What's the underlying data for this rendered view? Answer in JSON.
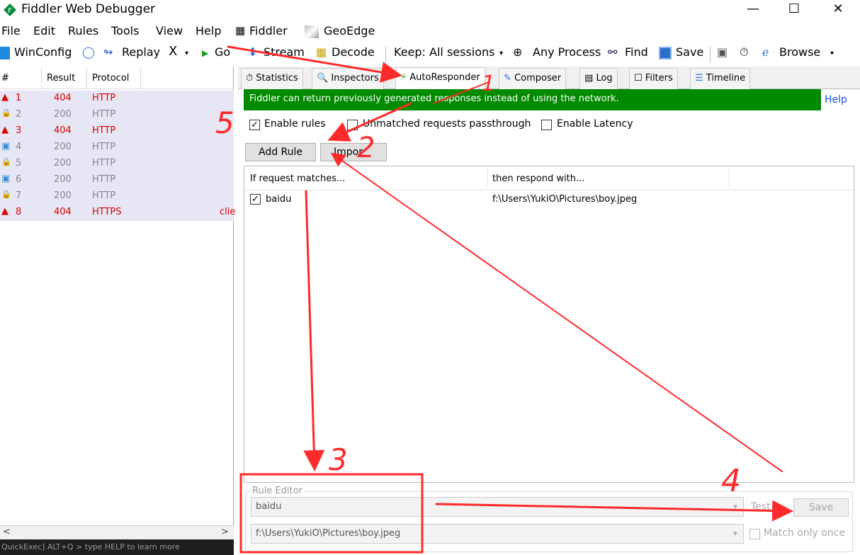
{
  "window": {
    "title": "Fiddler Web Debugger",
    "minimize": "—",
    "maximize": "☐",
    "close": "✕"
  },
  "menu": [
    "File",
    "Edit",
    "Rules",
    "Tools",
    "View",
    "Help",
    "Fiddler",
    "GeoEdge"
  ],
  "toolbar": {
    "winconfig": "WinConfig",
    "replay": "Replay",
    "x": "X",
    "go": "Go",
    "stream": "Stream",
    "decode": "Decode",
    "keep": "Keep: All sessions",
    "process": "Any Process",
    "find": "Find",
    "save": "Save",
    "browse": "Browse"
  },
  "sessions": {
    "headers": {
      "num": "#",
      "result": "Result",
      "protocol": "Protocol"
    },
    "rows": [
      {
        "num": "1",
        "result": "404",
        "protocol": "HTTP",
        "status": "error"
      },
      {
        "num": "2",
        "result": "200",
        "protocol": "HTTP",
        "status": "ok"
      },
      {
        "num": "3",
        "result": "404",
        "protocol": "HTTP",
        "status": "error"
      },
      {
        "num": "4",
        "result": "200",
        "protocol": "HTTP",
        "status": "ok"
      },
      {
        "num": "5",
        "result": "200",
        "protocol": "HTTP",
        "status": "ok"
      },
      {
        "num": "6",
        "result": "200",
        "protocol": "HTTP",
        "status": "ok"
      },
      {
        "num": "7",
        "result": "200",
        "protocol": "HTTP",
        "status": "ok"
      },
      {
        "num": "8",
        "result": "404",
        "protocol": "HTTPS",
        "status": "error",
        "extra": "clie"
      }
    ],
    "quickexec": "QuickExec] ALT+Q > type HELP to learn more"
  },
  "tabs": [
    "Statistics",
    "Inspectors",
    "AutoResponder",
    "Composer",
    "Log",
    "Filters",
    "Timeline"
  ],
  "autoresponder": {
    "banner": "Fiddler can return previously generated responses instead of using the network.",
    "help": "Help",
    "enable_rules": "Enable rules",
    "passthrough": "Unmatched requests passthrough",
    "latency": "Enable Latency",
    "add_rule": "Add Rule",
    "import": "Impor",
    "col_match": "If request matches...",
    "col_respond": "then respond with...",
    "rule": {
      "match": "baidu",
      "respond": "f:\\Users\\YukiO\\Pictures\\boy.jpeg"
    }
  },
  "rule_editor": {
    "legend": "Rule Editor",
    "match_value": "baidu",
    "respond_value": "f:\\Users\\YukiO\\Pictures\\boy.jpeg",
    "test": "Test",
    "save": "Save",
    "match_once": "Match only once"
  },
  "annotations": [
    "1",
    "2",
    "3",
    "4",
    "5"
  ],
  "colors": {
    "banner": "#008a00",
    "annotation": "#ff2a2a",
    "error": "#e00000"
  }
}
